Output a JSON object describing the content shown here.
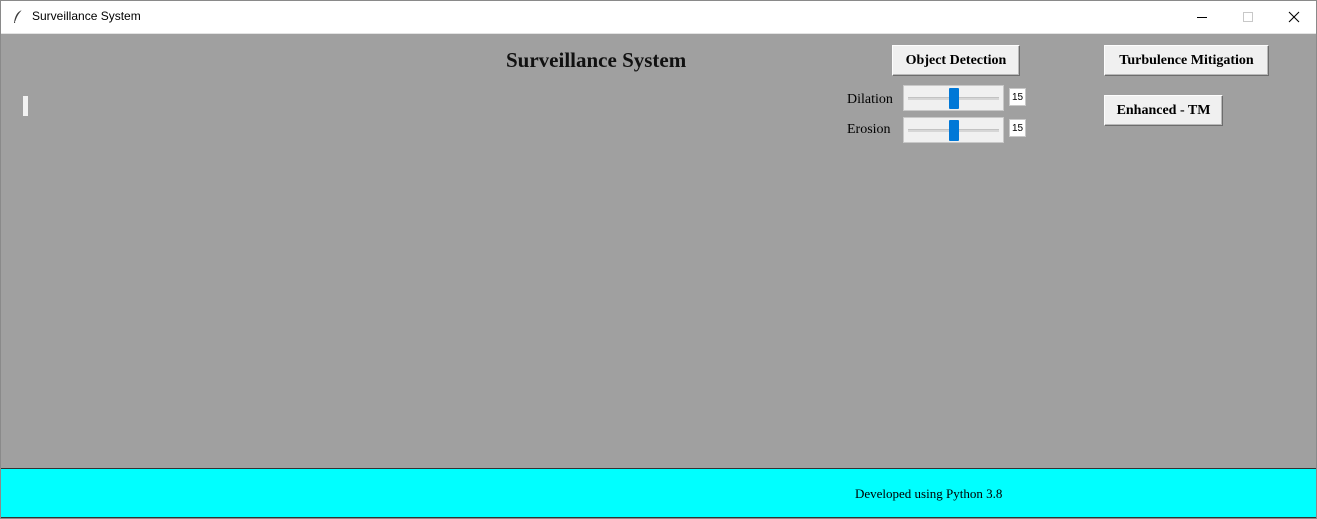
{
  "window": {
    "title": "Surveillance System",
    "controls": {
      "minimize": "—",
      "maximize": "☐",
      "close": "✕"
    }
  },
  "main": {
    "title": "Surveillance System",
    "background": "#a0a0a0",
    "buttons": {
      "object_detection": "Object Detection",
      "turbulence_mitigation": "Turbulence Mitigation",
      "enhanced_tm": "Enhanced - TM"
    },
    "sliders": [
      {
        "label": "Dilation",
        "value": "15",
        "fraction": 0.5
      },
      {
        "label": "Erosion",
        "value": "15",
        "fraction": 0.5
      }
    ],
    "slider_accent": "#0078d7"
  },
  "footer": {
    "text": "Developed using Python 3.8",
    "background": "#00ffff"
  },
  "icons": [
    "feather-icon",
    "minimize-icon",
    "maximize-icon",
    "close-icon"
  ]
}
